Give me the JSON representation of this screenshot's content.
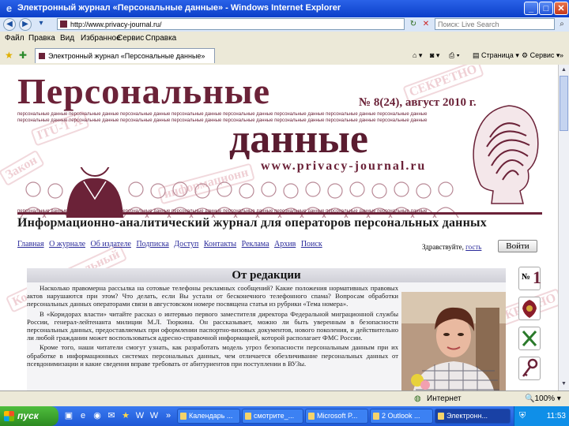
{
  "window": {
    "title": "Электронный журнал «Персональные данные» - Windows Internet Explorer"
  },
  "address": {
    "url": "http://www.privacy-journal.ru/",
    "search_placeholder": "Поиск: Live Search"
  },
  "menu": [
    "Файл",
    "Правка",
    "Вид",
    "Избранное",
    "Сервис",
    "Справка"
  ],
  "tab": {
    "label": "Электронный журнал «Персональные данные»"
  },
  "commands": {
    "page": "Страница",
    "tools": "Сервис"
  },
  "site": {
    "title_line1": "Персональные",
    "title_line2": "данные",
    "issue": "№ 8(24), август 2010 г.",
    "url": "www.privacy-journal.ru",
    "tagline": "Информационно-аналитический журнал для операторов персональных данных",
    "microtext": "персональные данные персональные данные персональные данные персональные данные персональные данные персональные данные персональные данные персональные данные",
    "nav": [
      "Главная",
      "О журнале",
      "Об издателе",
      "Подписка",
      "Доступ",
      "Контакты",
      "Реклама",
      "Архив",
      "Поиск"
    ],
    "greeting": "Здравствуйте,",
    "greeting_user": "гость",
    "login_button": "Войти",
    "editorial": {
      "heading": "От редакции",
      "paragraphs": [
        "Насколько правомерна рассылка на сотовые телефоны рекламных сообщений? Какие положения нормативных правовых актов нарушаются при этом? Что делать, если Вы устали от бесконечного телефонного спама? Вопросам обработки персональных данных операторами связи в августовском номере посвящена статья из рубрики «Тема номера».",
        "В «Коридорах власти» читайте рассказ о интервью первого заместителя директора Федеральной миграционной службы России, генерал-лейтенанта милиции М.Л. Тюркина. Он рассказывает, можно ли быть уверенным в безопасности персональных данных, предоставляемых при оформлении паспортно-визовых документов, нового поколения, и действительно ли любой гражданин может воспользоваться адресно-справочной информацией, которой располагает ФМС России.",
        "Кроме того, наши читатели смогут узнать, как разработать модель угроз безопасности персональным данным при их обработке в информационных системах персональных данных, чем отличается обезличивание персональных данных от псевдонимизации и какие сведения вправе требовать от абитуриентов при поступлении в ВУЗы."
      ]
    },
    "stamps": [
      "СЕКРЕТНО",
      "ITU-T X",
      "информационн",
      "СЕКРЕТНО",
      "Закон",
      "Конфиденциальный"
    ]
  },
  "status": {
    "zone": "Интернет",
    "zoom": "100%"
  },
  "taskbar": {
    "start": "пуск",
    "buttons": [
      "Календарь ...",
      "смотрите_...",
      "Microsoft P...",
      "2 Outlook ...",
      "Электронн..."
    ],
    "clock": "11:53"
  },
  "colors": {
    "brand": "#6b2238",
    "link": "#2a2a9a",
    "xp_blue": "#1e58d6"
  }
}
